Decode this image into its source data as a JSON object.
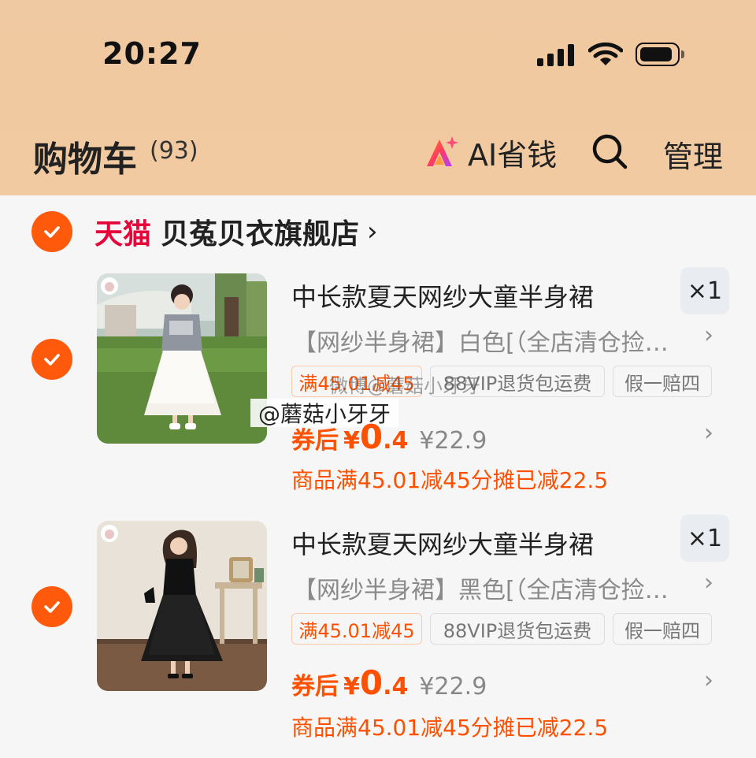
{
  "status_bar": {
    "time": "20:27"
  },
  "header": {
    "title": "购物车",
    "count": "(93)",
    "ai_label": "AI省钱",
    "manage_label": "管理"
  },
  "store": {
    "brand": "天猫",
    "name": "贝菟贝衣旗舰店",
    "chevron": "›"
  },
  "items": [
    {
      "title": "中长款夏天网纱大童半身裙",
      "qty": "×1",
      "sku": "【网纱半身裙】白色[（全店清仓捡…",
      "tags": [
        "满45.01减45",
        "88VIP退货包运费",
        "假一赔四"
      ],
      "after_label": "券后",
      "currency": "¥",
      "price_int": "0",
      "price_dec": ".4",
      "orig_price": "¥22.9",
      "discount_note": "商品满45.01减45分摊已减22.5"
    },
    {
      "title": "中长款夏天网纱大童半身裙",
      "qty": "×1",
      "sku": "【网纱半身裙】黑色[（全店清仓捡…",
      "tags": [
        "满45.01减45",
        "88VIP退货包运费",
        "假一赔四"
      ],
      "after_label": "券后",
      "currency": "¥",
      "price_int": "0",
      "price_dec": ".4",
      "orig_price": "¥22.9",
      "discount_note": "商品满45.01减45分摊已减22.5"
    }
  ],
  "watermark": {
    "overlay": "@蘑菇小牙牙",
    "faint": "微博@蘑菇小牙牙"
  },
  "colors": {
    "accent": "#ff5000",
    "check": "#ff5a0b",
    "tmall": "#e5073a",
    "header_bg": "#f1c9a0"
  },
  "icons": [
    "signal-icon",
    "wifi-icon",
    "battery-icon",
    "ai-sparkle-icon",
    "search-icon",
    "check-icon",
    "chevron-right-icon"
  ]
}
